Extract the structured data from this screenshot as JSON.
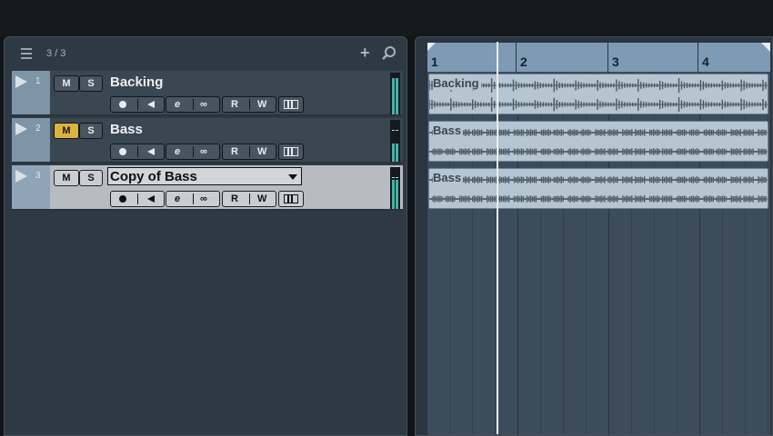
{
  "tracklist": {
    "count": "3 / 3",
    "add_glyph": "+",
    "tracks": [
      {
        "num": "1",
        "name": "Backing",
        "mute": "M",
        "solo": "S",
        "read": "R",
        "write": "W",
        "edit": "e",
        "mute_active": false,
        "selected": false
      },
      {
        "num": "2",
        "name": "Bass",
        "mute": "M",
        "solo": "S",
        "read": "R",
        "write": "W",
        "edit": "e",
        "mute_active": true,
        "selected": false
      },
      {
        "num": "3",
        "name": "Copy of Bass",
        "mute": "M",
        "solo": "S",
        "read": "R",
        "write": "W",
        "edit": "e",
        "mute_active": false,
        "selected": true
      }
    ]
  },
  "ruler": {
    "bars": [
      "1",
      "2",
      "3",
      "4"
    ]
  },
  "events": [
    {
      "label": "Backing"
    },
    {
      "label": "Bass"
    },
    {
      "label": "Bass"
    }
  ],
  "colors": {
    "mute_active": "#d9b43e",
    "ruler": "#7e9bb6",
    "event": "#b5c5d1",
    "meter": "#3fb6a8"
  }
}
